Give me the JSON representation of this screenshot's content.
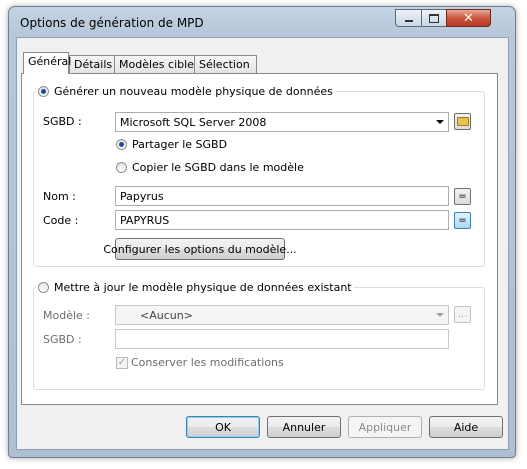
{
  "window": {
    "title": "Options de génération de MPD"
  },
  "tabs": [
    "Général",
    "Détails",
    "Modèles cible",
    "Sélection"
  ],
  "generate_group": {
    "radio_label": "Générer un nouveau modèle physique de données",
    "dbms_label": "SGBD :",
    "dbms_value": "Microsoft SQL Server 2008",
    "share_dbms_label": "Partager le SGBD",
    "copy_dbms_label": "Copier le SGBD dans le modèle",
    "name_label": "Nom :",
    "name_value": "Papyrus",
    "code_label": "Code :",
    "code_value": "PAPYRUS",
    "equals_symbol": "=",
    "configure_button": "Configurer les options du modèle..."
  },
  "update_group": {
    "radio_label": "Mettre à jour le modèle physique de données existant",
    "model_label": "Modèle :",
    "model_value": "<Aucun>",
    "browse_symbol": "...",
    "dbms_label": "SGBD :",
    "dbms_value": "",
    "keep_changes_label": "Conserver les modifications"
  },
  "buttons": {
    "ok": "OK",
    "cancel": "Annuler",
    "apply": "Appliquer",
    "help": "Aide"
  }
}
